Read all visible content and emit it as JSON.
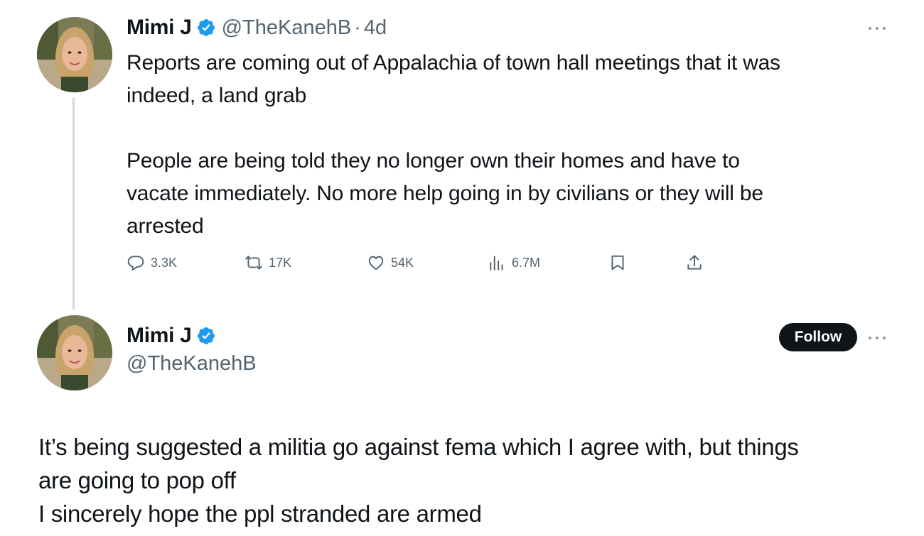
{
  "tweet1": {
    "display_name": "Mimi J",
    "handle": "@TheKanehB",
    "separator": "·",
    "time": "4d",
    "text": "Reports are coming out of Appalachia of town hall meetings that it was\nindeed, a land grab\n\nPeople are being told they no longer own their homes and have to\nvacate immediately. No more help going in by civilians or they will be\narrested",
    "actions": {
      "replies": "3.3K",
      "reposts": "17K",
      "likes": "54K",
      "views": "6.7M"
    }
  },
  "tweet2": {
    "display_name": "Mimi J",
    "handle": "@TheKanehB",
    "follow_label": "Follow",
    "text": "It’s being suggested a militia go against fema which I agree with, but things\nare going to pop off\nI sincerely hope the ppl stranded are armed"
  },
  "icons": {
    "verified": "verified-badge-icon",
    "more": "more-options-icon",
    "reply": "reply-icon",
    "repost": "repost-icon",
    "like": "heart-icon",
    "views": "views-icon",
    "bookmark": "bookmark-icon",
    "share": "share-icon"
  },
  "colors": {
    "verified_blue": "#1d9bf0",
    "secondary_text": "#536471",
    "primary_text": "#0f1419",
    "thread_line": "#cfd9de"
  }
}
